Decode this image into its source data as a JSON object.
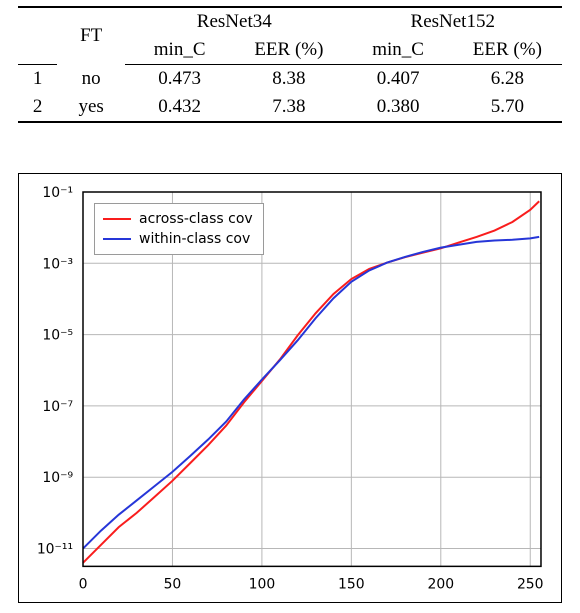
{
  "table": {
    "headers": {
      "ft": "FT",
      "groups": [
        "ResNet34",
        "ResNet152"
      ],
      "metrics": [
        "min_C",
        "EER (%)"
      ]
    },
    "rows": [
      {
        "n": "1",
        "ft": "no",
        "r34_minc": "0.473",
        "r34_eer": "8.38",
        "r152_minc": "0.407",
        "r152_eer": "6.28"
      },
      {
        "n": "2",
        "ft": "yes",
        "r34_minc": "0.432",
        "r34_eer": "7.38",
        "r152_minc": "0.380",
        "r152_eer": "5.70"
      }
    ]
  },
  "chart_data": {
    "type": "line",
    "xlabel": "",
    "ylabel": "",
    "xlim": [
      0,
      256
    ],
    "ylim_log10": [
      -11.5,
      -1
    ],
    "xticks": [
      0,
      50,
      100,
      150,
      200,
      250
    ],
    "ytick_exp": [
      -11,
      -9,
      -7,
      -5,
      -3,
      -1
    ],
    "ytick_labels": [
      "10⁻¹¹",
      "10⁻⁹",
      "10⁻⁷",
      "10⁻⁵",
      "10⁻³",
      "10⁻¹"
    ],
    "series": [
      {
        "name": "across-class cov",
        "color": "red",
        "x": [
          0,
          10,
          20,
          30,
          40,
          50,
          60,
          70,
          80,
          90,
          100,
          110,
          120,
          130,
          140,
          150,
          160,
          170,
          180,
          190,
          200,
          210,
          220,
          230,
          240,
          250,
          255
        ],
        "y_log10": [
          -11.4,
          -10.9,
          -10.4,
          -10.0,
          -9.55,
          -9.1,
          -8.6,
          -8.1,
          -7.55,
          -6.9,
          -6.3,
          -5.7,
          -5.02,
          -4.4,
          -3.86,
          -3.44,
          -3.16,
          -2.98,
          -2.83,
          -2.7,
          -2.58,
          -2.42,
          -2.26,
          -2.08,
          -1.84,
          -1.5,
          -1.26
        ]
      },
      {
        "name": "within-class cov",
        "color": "blue",
        "x": [
          0,
          10,
          20,
          30,
          40,
          50,
          60,
          70,
          80,
          90,
          100,
          110,
          120,
          130,
          140,
          150,
          160,
          170,
          180,
          190,
          200,
          210,
          220,
          230,
          240,
          250,
          255
        ],
        "y_log10": [
          -11.0,
          -10.5,
          -10.05,
          -9.65,
          -9.25,
          -8.85,
          -8.4,
          -7.94,
          -7.44,
          -6.82,
          -6.26,
          -5.72,
          -5.16,
          -4.54,
          -3.98,
          -3.52,
          -3.2,
          -2.98,
          -2.82,
          -2.68,
          -2.56,
          -2.48,
          -2.4,
          -2.36,
          -2.34,
          -2.3,
          -2.26
        ]
      }
    ],
    "legend": {
      "entries": [
        "across-class cov",
        "within-class cov"
      ]
    }
  }
}
